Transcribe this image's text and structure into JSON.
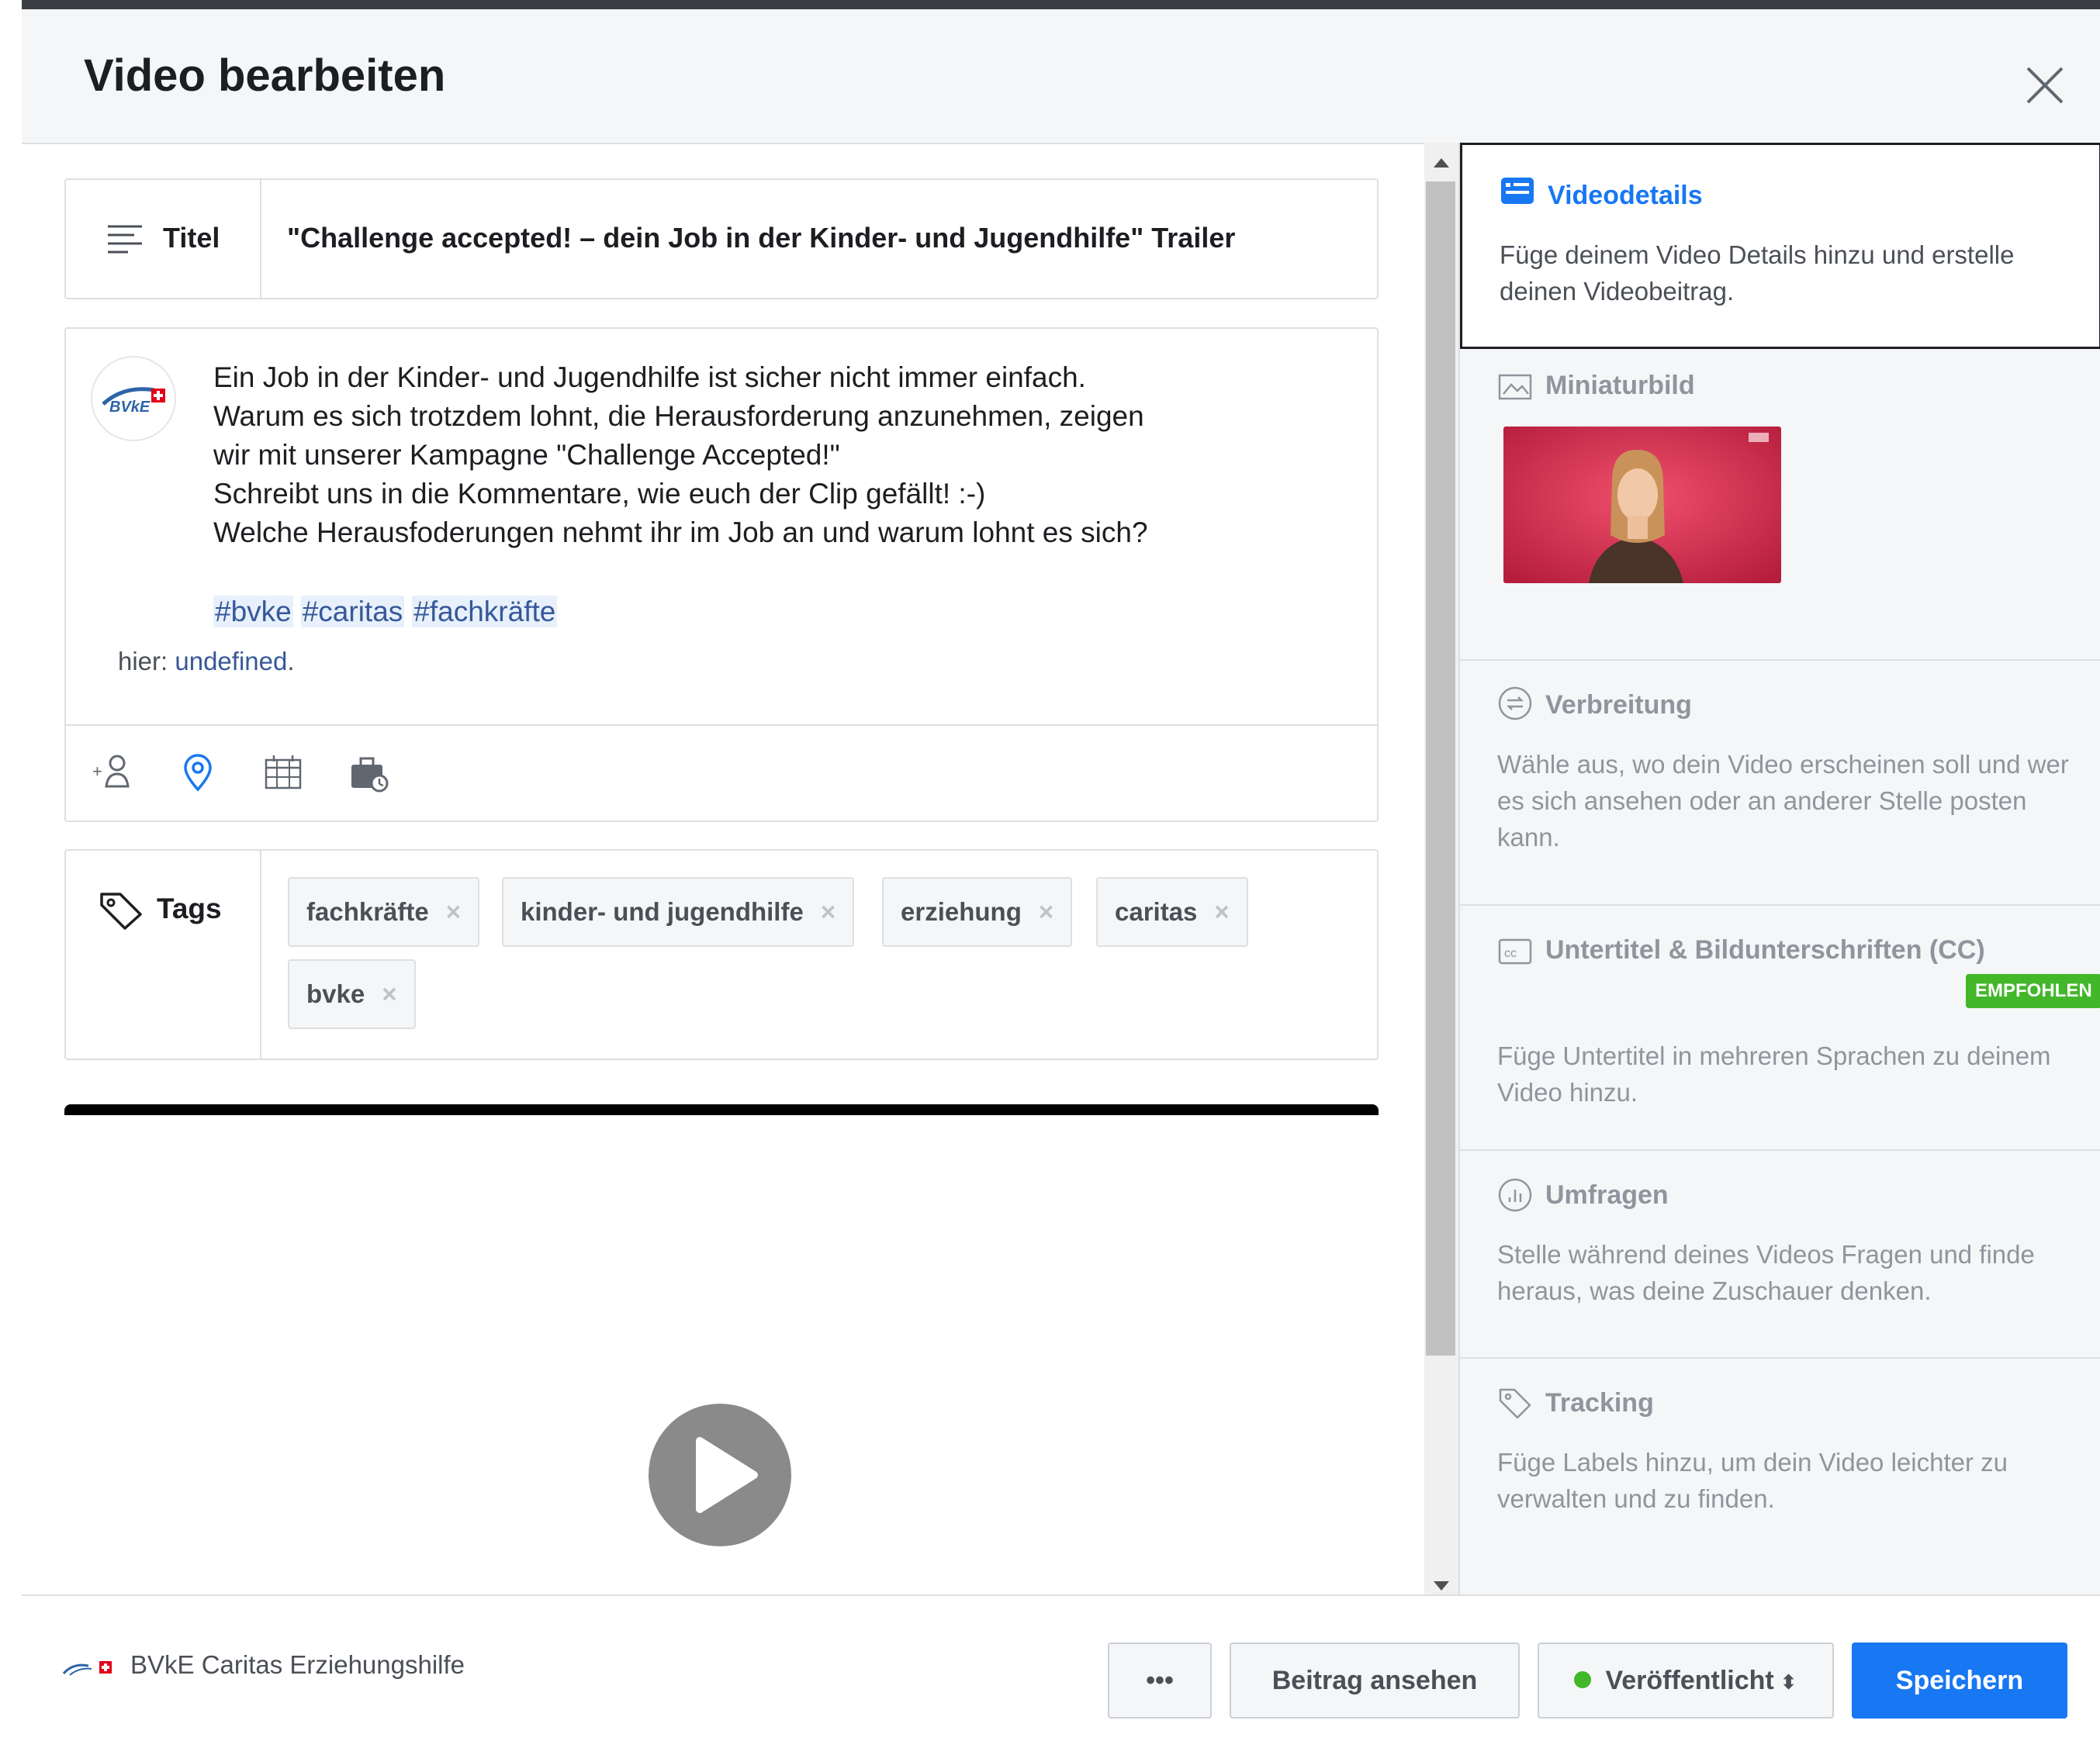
{
  "dialog": {
    "title": "Video bearbeiten"
  },
  "title_field": {
    "label": "Titel",
    "value": "\"Challenge accepted! – dein Job in der Kinder- und Jugendhilfe\" Trailer"
  },
  "post": {
    "text": "Ein Job in der Kinder- und Jugendhilfe ist sicher nicht immer einfach.\nWarum es sich trotzdem lohnt, die Herausforderung anzunehmen, zeigen\nwir mit unserer Kampagne \"Challenge Accepted!\"\nSchreibt uns in die Kommentare, wie euch der Clip gefällt! :-)\nWelche Herausfoderungen nehmt ihr im Job an und warum lohnt es sich?",
    "hashtags": [
      "#bvke",
      "#caritas",
      "#fachkräfte"
    ],
    "location_prefix": "hier: ",
    "location_value": "undefined",
    "location_suffix": ".",
    "avatar_logo": "BVkE",
    "tool_icons": [
      "tag-people-icon",
      "location-pin-icon",
      "calendar-icon",
      "briefcase-icon"
    ]
  },
  "tags": {
    "label": "Tags",
    "items": [
      "fachkräfte",
      "kinder- und jugendhilfe",
      "erziehung",
      "caritas",
      "bvke"
    ],
    "remove_glyph": "×"
  },
  "sidebar": {
    "sections": [
      {
        "title": "Videodetails",
        "description": "Füge deinem Video Details hinzu und erstelle deinen Videobeitrag.",
        "active": true,
        "icon": "video-details-icon"
      },
      {
        "title": "Miniaturbild",
        "description": "",
        "active": false,
        "icon": "thumbnail-icon"
      },
      {
        "title": "Verbreitung",
        "description": "Wähle aus, wo dein Video erscheinen soll und wer es sich ansehen oder an anderer Stelle posten kann.",
        "active": false,
        "icon": "distribution-icon"
      },
      {
        "title": "Untertitel & Bildunterschriften (CC)",
        "description": "Füge Untertitel in mehreren Sprachen zu deinem Video hinzu.",
        "badge": "EMPFOHLEN",
        "active": false,
        "icon": "cc-icon"
      },
      {
        "title": "Umfragen",
        "description": "Stelle während deines Videos Fragen und finde heraus, was deine Zuschauer denken.",
        "active": false,
        "icon": "polls-icon"
      },
      {
        "title": "Tracking",
        "description": "Füge Labels hinzu, um dein Video leichter zu verwalten und zu finden.",
        "active": false,
        "icon": "tracking-tag-icon"
      }
    ]
  },
  "footer": {
    "page_name": "BVkE Caritas Erziehungshilfe",
    "more_label": "•••",
    "view_post_label": "Beitrag ansehen",
    "status_label": "Veröffentlicht",
    "status_caret": "⬍",
    "save_label": "Speichern"
  },
  "colors": {
    "accent": "#1877f2",
    "badge_green": "#42b72a",
    "status_green": "#42b72a",
    "hashtag_bg": "#e7f0fb",
    "link": "#365899",
    "thumbnail_bg": "#d42a4e"
  }
}
